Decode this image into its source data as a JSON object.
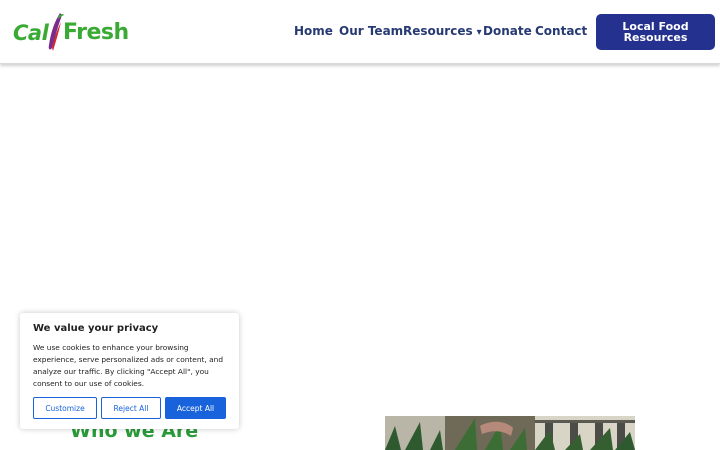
{
  "header": {
    "logo": {
      "part1": "Cal",
      "part2": "Fresh"
    },
    "nav": [
      {
        "label": "Home",
        "name": "nav-home"
      },
      {
        "label": "Our Team",
        "name": "nav-our-team"
      },
      {
        "label": "Resources",
        "name": "nav-resources",
        "caret": "▾"
      },
      {
        "label": "Donate",
        "name": "nav-donate"
      },
      {
        "label": "Contact",
        "name": "nav-contact"
      }
    ],
    "cta_label": "Local Food Resources"
  },
  "main": {
    "section_heading": "Who we Are"
  },
  "cookie_banner": {
    "title": "We value your privacy",
    "text": "We use cookies to enhance your browsing experience, serve personalized ads or content, and analyze our traffic. By clicking \"Accept All\", you consent to our use of cookies.",
    "customize_label": "Customize",
    "reject_label": "Reject All",
    "accept_label": "Accept All"
  },
  "colors": {
    "brand_green": "#3aaa35",
    "nav_text": "#273a73",
    "cta_bg": "#24318e",
    "cookie_accent": "#1863dc"
  }
}
